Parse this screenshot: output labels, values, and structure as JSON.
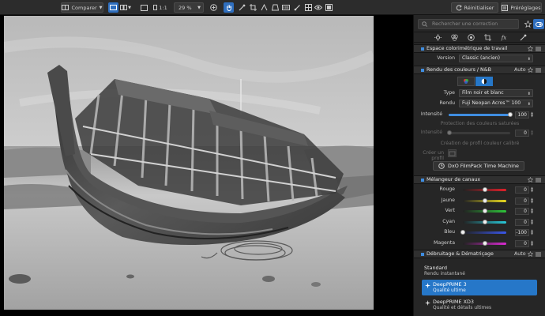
{
  "toolbar": {
    "compare_label": "Comparer",
    "ratio_label": "1:1",
    "zoom_value": "29 %",
    "reset_label": "Réinitialiser",
    "presets_label": "Préréglages",
    "selection_color": "#2f6fbf"
  },
  "panel": {
    "search_placeholder": "Rechercher une correction",
    "tabs": [
      "sun-icon",
      "color-circles-icon",
      "target-icon",
      "crop-icon",
      "fx-icon",
      "eyedropper-icon"
    ],
    "color_space": {
      "title": "Espace colorimétrique de travail",
      "version_label": "Version",
      "version_value": "Classic (ancien)"
    },
    "color_rendering": {
      "title": "Rendu des couleurs / N&B",
      "auto": "Auto",
      "type_label": "Type",
      "type_value": "Film noir et blanc",
      "rendering_label": "Rendu",
      "rendering_value": "Fuji Neopan Acros™ 100",
      "intensity_label": "Intensité",
      "intensity_value": "100",
      "intensity_fraction": 1.0,
      "protect_label": "Protection des couleurs saturées",
      "intensity2_label": "Intensité",
      "intensity2_value": "0",
      "profile_label": "Création de profil couleur calibré",
      "create_profile_label": "Créer un profil",
      "timemachine_label": "DxO FilmPack Time Machine"
    },
    "channel_mixer": {
      "title": "Mélangeur de canaux",
      "channels": [
        {
          "name": "Rouge",
          "value": "0",
          "pos": 0.5,
          "gradient": "linear-gradient(90deg,#222,#e0202a)"
        },
        {
          "name": "Jaune",
          "value": "0",
          "pos": 0.5,
          "gradient": "linear-gradient(90deg,#222,#e8d820)"
        },
        {
          "name": "Vert",
          "value": "0",
          "pos": 0.5,
          "gradient": "linear-gradient(90deg,#222,#2ec43a)"
        },
        {
          "name": "Cyan",
          "value": "0",
          "pos": 0.5,
          "gradient": "linear-gradient(90deg,#222,#28c8d8)"
        },
        {
          "name": "Bleu",
          "value": "-100",
          "pos": 0.0,
          "gradient": "linear-gradient(90deg,#222,#3a56e8)"
        },
        {
          "name": "Magenta",
          "value": "0",
          "pos": 0.5,
          "gradient": "linear-gradient(90deg,#222,#d82ad0)"
        }
      ]
    },
    "demosaic": {
      "title": "Débruitage & Dématriçage",
      "auto": "Auto",
      "options": [
        {
          "title": "Standard",
          "subtitle": "Rendu instantané"
        },
        {
          "title": "DeepPRIME 3",
          "subtitle": "Qualité ultime"
        },
        {
          "title": "DeepPRIME XD3",
          "subtitle": "Qualité et détails ultimes"
        }
      ]
    }
  }
}
